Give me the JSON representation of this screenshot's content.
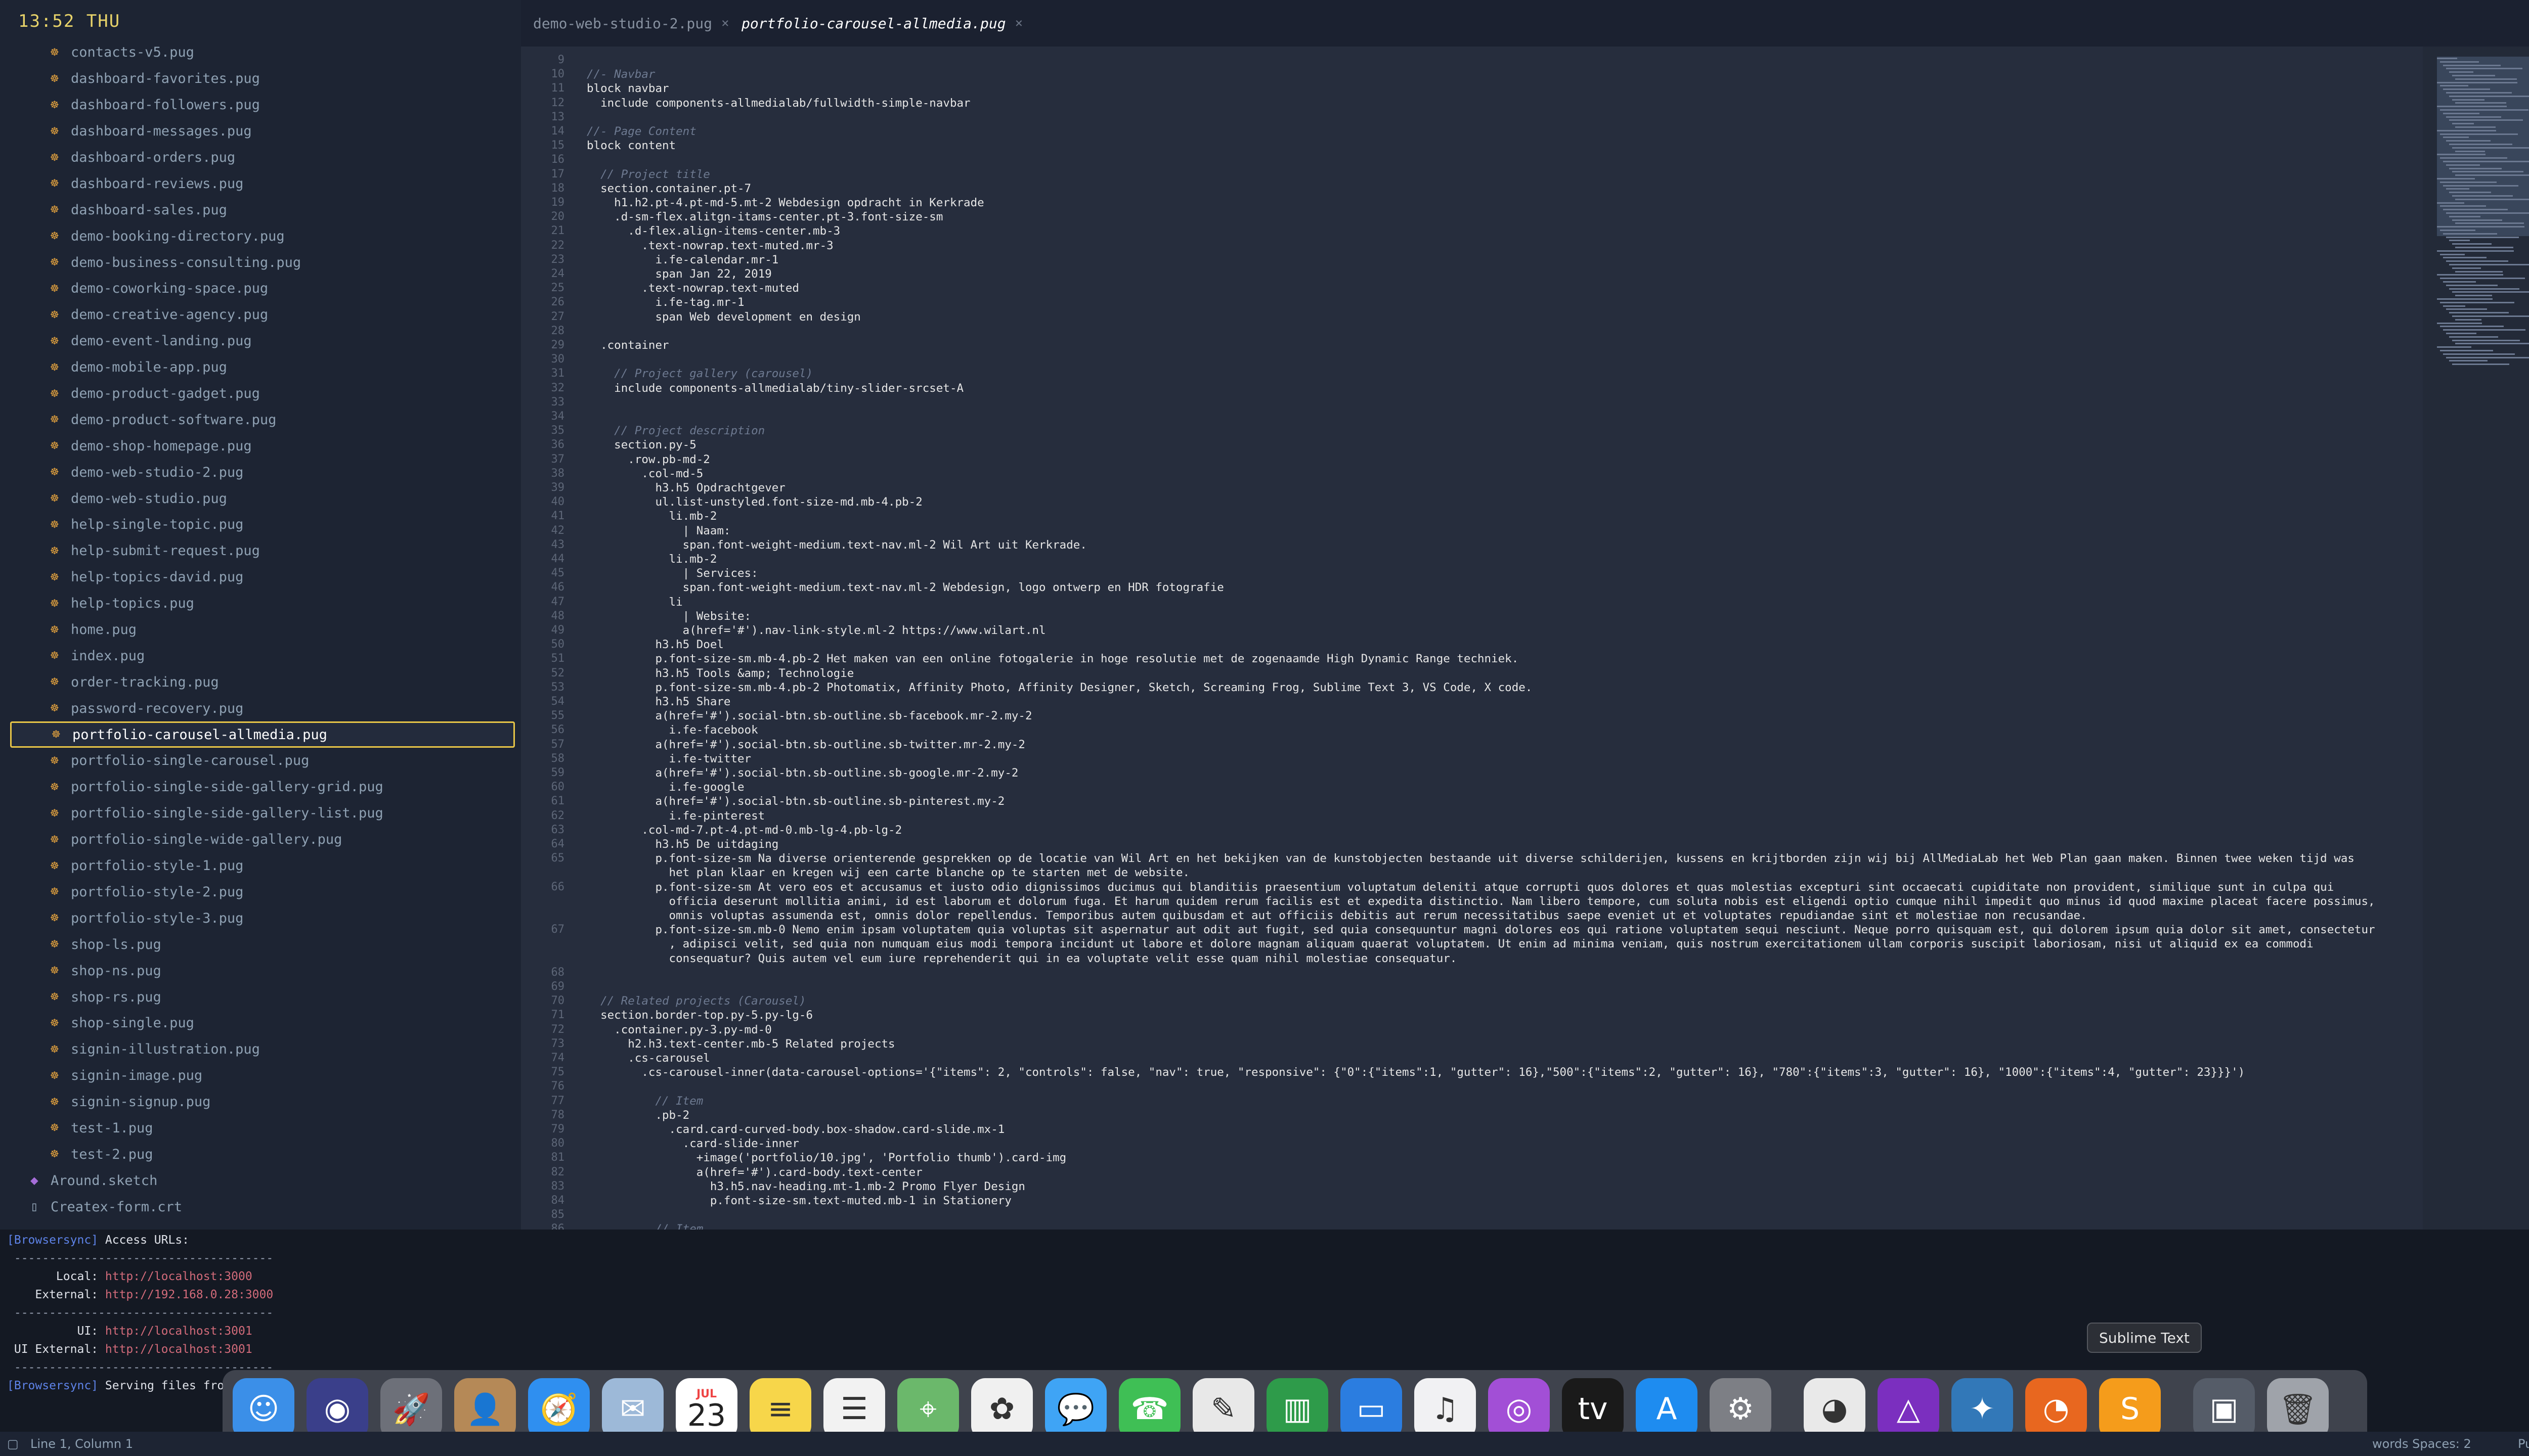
{
  "clock": "13:52 THU",
  "sidebar": {
    "files": [
      {
        "label": "contacts-v5.pug",
        "icon": "pug-icon"
      },
      {
        "label": "dashboard-favorites.pug",
        "icon": "pug-icon"
      },
      {
        "label": "dashboard-followers.pug",
        "icon": "pug-icon"
      },
      {
        "label": "dashboard-messages.pug",
        "icon": "pug-icon"
      },
      {
        "label": "dashboard-orders.pug",
        "icon": "pug-icon"
      },
      {
        "label": "dashboard-reviews.pug",
        "icon": "pug-icon"
      },
      {
        "label": "dashboard-sales.pug",
        "icon": "pug-icon"
      },
      {
        "label": "demo-booking-directory.pug",
        "icon": "pug-icon"
      },
      {
        "label": "demo-business-consulting.pug",
        "icon": "pug-icon"
      },
      {
        "label": "demo-coworking-space.pug",
        "icon": "pug-icon"
      },
      {
        "label": "demo-creative-agency.pug",
        "icon": "pug-icon"
      },
      {
        "label": "demo-event-landing.pug",
        "icon": "pug-icon"
      },
      {
        "label": "demo-mobile-app.pug",
        "icon": "pug-icon"
      },
      {
        "label": "demo-product-gadget.pug",
        "icon": "pug-icon"
      },
      {
        "label": "demo-product-software.pug",
        "icon": "pug-icon"
      },
      {
        "label": "demo-shop-homepage.pug",
        "icon": "pug-icon"
      },
      {
        "label": "demo-web-studio-2.pug",
        "icon": "pug-icon"
      },
      {
        "label": "demo-web-studio.pug",
        "icon": "pug-icon"
      },
      {
        "label": "help-single-topic.pug",
        "icon": "pug-icon"
      },
      {
        "label": "help-submit-request.pug",
        "icon": "pug-icon"
      },
      {
        "label": "help-topics-david.pug",
        "icon": "pug-icon"
      },
      {
        "label": "help-topics.pug",
        "icon": "pug-icon"
      },
      {
        "label": "home.pug",
        "icon": "pug-icon"
      },
      {
        "label": "index.pug",
        "icon": "pug-icon"
      },
      {
        "label": "order-tracking.pug",
        "icon": "pug-icon"
      },
      {
        "label": "password-recovery.pug",
        "icon": "pug-icon"
      },
      {
        "label": "portfolio-carousel-allmedia.pug",
        "icon": "pug-icon",
        "selected": true
      },
      {
        "label": "portfolio-single-carousel.pug",
        "icon": "pug-icon"
      },
      {
        "label": "portfolio-single-side-gallery-grid.pug",
        "icon": "pug-icon"
      },
      {
        "label": "portfolio-single-side-gallery-list.pug",
        "icon": "pug-icon"
      },
      {
        "label": "portfolio-single-wide-gallery.pug",
        "icon": "pug-icon"
      },
      {
        "label": "portfolio-style-1.pug",
        "icon": "pug-icon"
      },
      {
        "label": "portfolio-style-2.pug",
        "icon": "pug-icon"
      },
      {
        "label": "portfolio-style-3.pug",
        "icon": "pug-icon"
      },
      {
        "label": "shop-ls.pug",
        "icon": "pug-icon"
      },
      {
        "label": "shop-ns.pug",
        "icon": "pug-icon"
      },
      {
        "label": "shop-rs.pug",
        "icon": "pug-icon"
      },
      {
        "label": "shop-single.pug",
        "icon": "pug-icon"
      },
      {
        "label": "signin-illustration.pug",
        "icon": "pug-icon"
      },
      {
        "label": "signin-image.pug",
        "icon": "pug-icon"
      },
      {
        "label": "signin-signup.pug",
        "icon": "pug-icon"
      },
      {
        "label": "test-1.pug",
        "icon": "pug-icon"
      },
      {
        "label": "test-2.pug",
        "icon": "pug-icon"
      },
      {
        "label": "Around.sketch",
        "icon": "sketch-icon",
        "plain": true
      },
      {
        "label": "Createx-form.crt",
        "icon": "document-icon",
        "plain": true
      }
    ]
  },
  "tabs": [
    {
      "label": "demo-web-studio-2.pug",
      "active": false
    },
    {
      "label": "portfolio-carousel-allmedia.pug",
      "active": true
    }
  ],
  "editor": {
    "lines": [
      {
        "n": "9",
        "t": ""
      },
      {
        "n": "10",
        "t": "//- Navbar",
        "c": "cmt"
      },
      {
        "n": "11",
        "t": "block navbar"
      },
      {
        "n": "12",
        "t": "  include components-allmedialab/fullwidth-simple-navbar"
      },
      {
        "n": "13",
        "t": ""
      },
      {
        "n": "14",
        "t": "//- Page Content",
        "c": "cmt"
      },
      {
        "n": "15",
        "t": "block content"
      },
      {
        "n": "16",
        "t": ""
      },
      {
        "n": "17",
        "t": "  // Project title",
        "c": "cmt"
      },
      {
        "n": "18",
        "t": "  section.container.pt-7"
      },
      {
        "n": "19",
        "t": "    h1.h2.pt-4.pt-md-5.mt-2 Webdesign opdracht in Kerkrade"
      },
      {
        "n": "20",
        "t": "    .d-sm-flex.alitgn-itams-center.pt-3.font-size-sm"
      },
      {
        "n": "21",
        "t": "      .d-flex.align-items-center.mb-3"
      },
      {
        "n": "22",
        "t": "        .text-nowrap.text-muted.mr-3"
      },
      {
        "n": "23",
        "t": "          i.fe-calendar.mr-1"
      },
      {
        "n": "24",
        "t": "          span Jan 22, 2019"
      },
      {
        "n": "25",
        "t": "        .text-nowrap.text-muted"
      },
      {
        "n": "26",
        "t": "          i.fe-tag.mr-1"
      },
      {
        "n": "27",
        "t": "          span Web development en design"
      },
      {
        "n": "28",
        "t": ""
      },
      {
        "n": "29",
        "t": "  .container"
      },
      {
        "n": "30",
        "t": ""
      },
      {
        "n": "31",
        "t": "    // Project gallery (carousel)",
        "c": "cmt"
      },
      {
        "n": "32",
        "t": "    include components-allmedialab/tiny-slider-srcset-A"
      },
      {
        "n": "33",
        "t": ""
      },
      {
        "n": "34",
        "t": ""
      },
      {
        "n": "35",
        "t": "    // Project description",
        "c": "cmt"
      },
      {
        "n": "36",
        "t": "    section.py-5"
      },
      {
        "n": "37",
        "t": "      .row.pb-md-2"
      },
      {
        "n": "38",
        "t": "        .col-md-5"
      },
      {
        "n": "39",
        "t": "          h3.h5 Opdrachtgever"
      },
      {
        "n": "40",
        "t": "          ul.list-unstyled.font-size-md.mb-4.pb-2"
      },
      {
        "n": "41",
        "t": "            li.mb-2"
      },
      {
        "n": "42",
        "t": "              | Naam:"
      },
      {
        "n": "43",
        "t": "              span.font-weight-medium.text-nav.ml-2 Wil Art uit Kerkrade."
      },
      {
        "n": "44",
        "t": "            li.mb-2"
      },
      {
        "n": "45",
        "t": "              | Services:"
      },
      {
        "n": "46",
        "t": "              span.font-weight-medium.text-nav.ml-2 Webdesign, logo ontwerp en HDR fotografie"
      },
      {
        "n": "47",
        "t": "            li"
      },
      {
        "n": "48",
        "t": "              | Website:"
      },
      {
        "n": "49",
        "t": "              a(href='#').nav-link-style.ml-2 https://www.wilart.nl"
      },
      {
        "n": "50",
        "t": "          h3.h5 Doel"
      },
      {
        "n": "51",
        "t": "          p.font-size-sm.mb-4.pb-2 Het maken van een online fotogalerie in hoge resolutie met de zogenaamde High Dynamic Range techniek."
      },
      {
        "n": "52",
        "t": "          h3.h5 Tools &amp; Technologie"
      },
      {
        "n": "53",
        "t": "          p.font-size-sm.mb-4.pb-2 Photomatix, Affinity Photo, Affinity Designer, Sketch, Screaming Frog, Sublime Text 3, VS Code, X code."
      },
      {
        "n": "54",
        "t": "          h3.h5 Share"
      },
      {
        "n": "55",
        "t": "          a(href='#').social-btn.sb-outline.sb-facebook.mr-2.my-2"
      },
      {
        "n": "56",
        "t": "            i.fe-facebook"
      },
      {
        "n": "57",
        "t": "          a(href='#').social-btn.sb-outline.sb-twitter.mr-2.my-2"
      },
      {
        "n": "58",
        "t": "            i.fe-twitter"
      },
      {
        "n": "59",
        "t": "          a(href='#').social-btn.sb-outline.sb-google.mr-2.my-2"
      },
      {
        "n": "60",
        "t": "            i.fe-google"
      },
      {
        "n": "61",
        "t": "          a(href='#').social-btn.sb-outline.sb-pinterest.my-2"
      },
      {
        "n": "62",
        "t": "            i.fe-pinterest"
      },
      {
        "n": "63",
        "t": "        .col-md-7.pt-4.pt-md-0.mb-lg-4.pb-lg-2"
      },
      {
        "n": "64",
        "t": "          h3.h5 De uitdaging"
      },
      {
        "n": "65",
        "t": "          p.font-size-sm Na diverse orienterende gesprekken op de locatie van Wil Art en het bekijken van de kunstobjecten bestaande uit diverse schilderijen, kussens en krijtborden zijn wij bij AllMediaLab het Web Plan gaan maken. Binnen twee weken tijd was"
      },
      {
        "n": "",
        "t": "            het plan klaar en kregen wij een carte blanche op te starten met de website."
      },
      {
        "n": "66",
        "t": "          p.font-size-sm At vero eos et accusamus et iusto odio dignissimos ducimus qui blanditiis praesentium voluptatum deleniti atque corrupti quos dolores et quas molestias excepturi sint occaecati cupiditate non provident, similique sunt in culpa qui"
      },
      {
        "n": "",
        "t": "            officia deserunt mollitia animi, id est laborum et dolorum fuga. Et harum quidem rerum facilis est et expedita distinctio. Nam libero tempore, cum soluta nobis est eligendi optio cumque nihil impedit quo minus id quod maxime placeat facere possimus,"
      },
      {
        "n": "",
        "t": "            omnis voluptas assumenda est, omnis dolor repellendus. Temporibus autem quibusdam et aut officiis debitis aut rerum necessitatibus saepe eveniet ut et voluptates repudiandae sint et molestiae non recusandae."
      },
      {
        "n": "67",
        "t": "          p.font-size-sm.mb-0 Nemo enim ipsam voluptatem quia voluptas sit aspernatur aut odit aut fugit, sed quia consequuntur magni dolores eos qui ratione voluptatem sequi nesciunt. Neque porro quisquam est, qui dolorem ipsum quia dolor sit amet, consectetur"
      },
      {
        "n": "",
        "t": "            , adipisci velit, sed quia non numquam eius modi tempora incidunt ut labore et dolore magnam aliquam quaerat voluptatem. Ut enim ad minima veniam, quis nostrum exercitationem ullam corporis suscipit laboriosam, nisi ut aliquid ex ea commodi"
      },
      {
        "n": "",
        "t": "            consequatur? Quis autem vel eum iure reprehenderit qui in ea voluptate velit esse quam nihil molestiae consequatur."
      },
      {
        "n": "68",
        "t": ""
      },
      {
        "n": "69",
        "t": ""
      },
      {
        "n": "70",
        "t": "  // Related projects (Carousel)",
        "c": "cmt"
      },
      {
        "n": "71",
        "t": "  section.border-top.py-5.py-lg-6"
      },
      {
        "n": "72",
        "t": "    .container.py-3.py-md-0"
      },
      {
        "n": "73",
        "t": "      h2.h3.text-center.mb-5 Related projects"
      },
      {
        "n": "74",
        "t": "      .cs-carousel"
      },
      {
        "n": "75",
        "t": "        .cs-carousel-inner(data-carousel-options='{\"items\": 2, \"controls\": false, \"nav\": true, \"responsive\": {\"0\":{\"items\":1, \"gutter\": 16},\"500\":{\"items\":2, \"gutter\": 16}, \"780\":{\"items\":3, \"gutter\": 16}, \"1000\":{\"items\":4, \"gutter\": 23}}}')"
      },
      {
        "n": "76",
        "t": ""
      },
      {
        "n": "77",
        "t": "          // Item",
        "c": "cmt"
      },
      {
        "n": "78",
        "t": "          .pb-2"
      },
      {
        "n": "79",
        "t": "            .card.card-curved-body.box-shadow.card-slide.mx-1"
      },
      {
        "n": "80",
        "t": "              .card-slide-inner"
      },
      {
        "n": "81",
        "t": "                +image('portfolio/10.jpg', 'Portfolio thumb').card-img"
      },
      {
        "n": "82",
        "t": "                a(href='#').card-body.text-center"
      },
      {
        "n": "83",
        "t": "                  h3.h5.nav-heading.mt-1.mb-2 Promo Flyer Design"
      },
      {
        "n": "84",
        "t": "                  p.font-size-sm.text-muted.mb-1 in Stationery"
      },
      {
        "n": "85",
        "t": ""
      },
      {
        "n": "86",
        "t": "          // Item",
        "c": "cmt"
      }
    ]
  },
  "terminal": {
    "lines": [
      {
        "prefix": "[Browsersync]",
        "text": " Access URLs:"
      },
      {
        "sep": " -------------------------------------"
      },
      {
        "label": "       Local: ",
        "url": "http://localhost:3000"
      },
      {
        "label": "    External: ",
        "url": "http://192.168.0.28:3000"
      },
      {
        "sep": " -------------------------------------"
      },
      {
        "label": "          UI: ",
        "url": "http://localhost:3001"
      },
      {
        "label": " UI External: ",
        "url": "http://localhost:3001"
      },
      {
        "sep": " -------------------------------------"
      },
      {
        "prefix": "[Browsersync]",
        "text": " Serving files fro"
      }
    ]
  },
  "dock": {
    "tooltip": "Sublime Text",
    "calendar_day": "23",
    "calendar_month": "JUL",
    "apps": [
      {
        "name": "finder-icon",
        "color": "#3b8fe8",
        "glyph": "☺"
      },
      {
        "name": "siri-icon",
        "color": "#3a3f8a",
        "glyph": "◉"
      },
      {
        "name": "launchpad-icon",
        "color": "#6d7079",
        "glyph": "🚀"
      },
      {
        "name": "contacts-icon",
        "color": "#b58957",
        "glyph": "👤"
      },
      {
        "name": "safari-icon",
        "color": "#2f8ff0",
        "glyph": "🧭"
      },
      {
        "name": "mail-icon",
        "color": "#9db9d8",
        "glyph": "✉"
      },
      {
        "name": "calendar-icon",
        "color": "#ffffff",
        "glyph": "cal"
      },
      {
        "name": "notes-icon",
        "color": "#f7d64a",
        "glyph": "≡"
      },
      {
        "name": "reminders-icon",
        "color": "#f2f2f2",
        "glyph": "☰"
      },
      {
        "name": "maps-icon",
        "color": "#6bb86b",
        "glyph": "⌖"
      },
      {
        "name": "photos-icon",
        "color": "#f0f0f0",
        "glyph": "✿"
      },
      {
        "name": "messages-icon",
        "color": "#3fa4f5",
        "glyph": "💬"
      },
      {
        "name": "facetime-icon",
        "color": "#3fbf55",
        "glyph": "☎"
      },
      {
        "name": "textedit-icon",
        "color": "#e8e8e8",
        "glyph": "✎"
      },
      {
        "name": "numbers-icon",
        "color": "#2e9b4a",
        "glyph": "▥"
      },
      {
        "name": "keynote-icon",
        "color": "#2b7de0",
        "glyph": "▭"
      },
      {
        "name": "music-icon",
        "color": "#f1f1f3",
        "glyph": "♫"
      },
      {
        "name": "podcasts-icon",
        "color": "#a24fd6",
        "glyph": "◎"
      },
      {
        "name": "appletv-icon",
        "color": "#1a1a1a",
        "glyph": "tv"
      },
      {
        "name": "appstore-icon",
        "color": "#1e8cf0",
        "glyph": "A"
      },
      {
        "name": "system-preferences-icon",
        "color": "#7d7f85",
        "glyph": "⚙"
      },
      {
        "name": "chrome-icon",
        "color": "#e9e9e9",
        "glyph": "◕"
      },
      {
        "name": "affinity-designer-icon",
        "color": "#7b2fbf",
        "glyph": "△"
      },
      {
        "name": "mindnode-icon",
        "color": "#3278b8",
        "glyph": "✦"
      },
      {
        "name": "firefox-icon",
        "color": "#e8671f",
        "glyph": "◔"
      },
      {
        "name": "sublime-text-icon",
        "color": "#f59c1b",
        "glyph": "S"
      },
      {
        "name": "downloads-stack-icon",
        "color": "#555c68",
        "glyph": "▣"
      },
      {
        "name": "trash-icon",
        "color": "#9fa3aa",
        "glyph": "🗑"
      }
    ]
  },
  "status": {
    "position": "Line 1, Column 1",
    "right": "words  Spaces: 2",
    "syntax": "Pug"
  }
}
